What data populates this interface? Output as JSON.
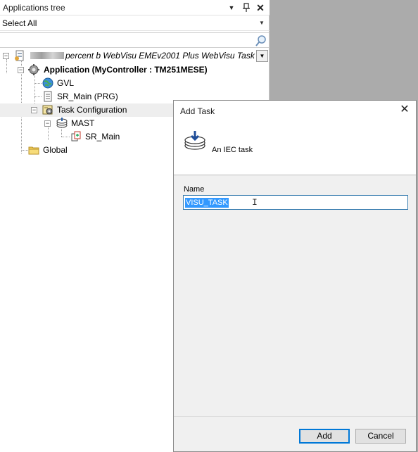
{
  "panel": {
    "title": "Applications tree",
    "filter": "Select All",
    "search_placeholder": ""
  },
  "tree": {
    "root_label": "percent b WebVisu EMEv2001 Plus WebVisu Task",
    "application_label": "Application (MyController : TM251MESE)",
    "gvl_label": "GVL",
    "sr_main_prg_label": "SR_Main (PRG)",
    "task_config_label": "Task Configuration",
    "mast_label": "MAST",
    "sr_main_label": "SR_Main",
    "global_label": "Global"
  },
  "dialog": {
    "title": "Add Task",
    "description": "An IEC task",
    "name_label": "Name",
    "name_value": "VISU_TASK",
    "add_label": "Add",
    "cancel_label": "Cancel"
  },
  "colors": {
    "selection": "#3399ff",
    "focus_border": "#0078d7",
    "background_gray": "#ababab"
  }
}
